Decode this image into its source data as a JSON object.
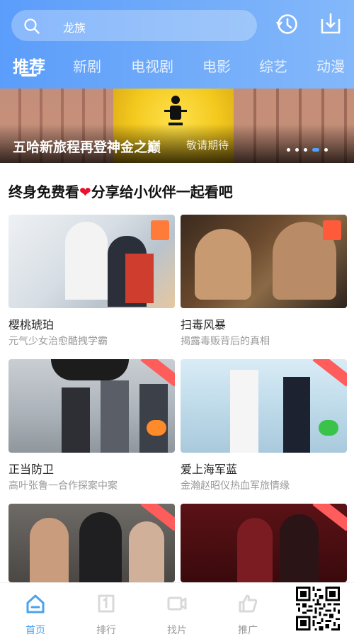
{
  "search": {
    "query": "龙族"
  },
  "header_icons": [
    "history-icon",
    "download-icon"
  ],
  "tabs": [
    {
      "label": "推荐",
      "active": true
    },
    {
      "label": "新剧"
    },
    {
      "label": "电视剧"
    },
    {
      "label": "电影"
    },
    {
      "label": "综艺"
    },
    {
      "label": "动漫"
    }
  ],
  "banner": {
    "title": "五哈新旅程再登神金之巅",
    "subtitle": "敬请期待"
  },
  "section": {
    "title_part1": "终身免费看",
    "heart": "❤",
    "title_part2": "分享给小伙伴一起看吧"
  },
  "cards": [
    {
      "title": "樱桃琥珀",
      "subtitle": "元气少女治愈酷拽学霸"
    },
    {
      "title": "扫毒风暴",
      "subtitle": "揭露毒贩背后的真相"
    },
    {
      "title": "正当防卫",
      "subtitle": "高叶张鲁一合作探案中案"
    },
    {
      "title": "爱上海军蓝",
      "subtitle": "金瀚赵昭仪热血军旅情缘"
    },
    {
      "title": "",
      "subtitle": ""
    },
    {
      "title": "",
      "subtitle": ""
    }
  ],
  "bottom_nav": [
    {
      "label": "首页",
      "icon": "home-icon",
      "active": true
    },
    {
      "label": "排行",
      "icon": "ranking-icon"
    },
    {
      "label": "找片",
      "icon": "video-icon"
    },
    {
      "label": "推广",
      "icon": "thumbs-up-icon"
    }
  ],
  "colors": {
    "accent": "#4aa3ee",
    "header_start": "#5b9dfb",
    "header_end": "#84b8fb",
    "heart": "#e8122e",
    "tag": "#ff5c5c"
  }
}
